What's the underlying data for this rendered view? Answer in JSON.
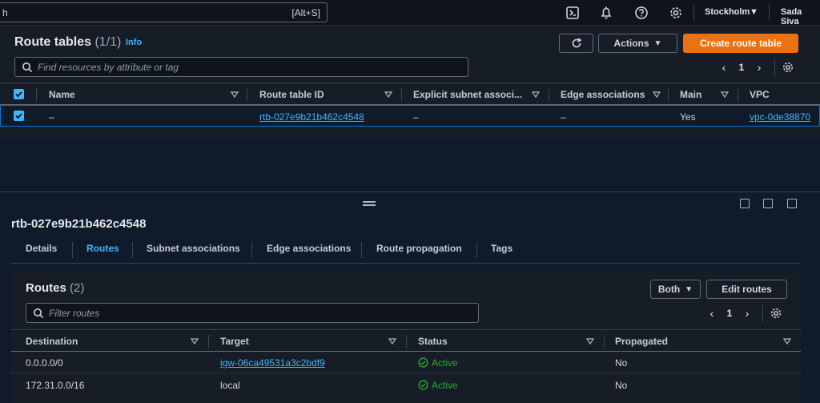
{
  "topnav": {
    "search_value": "h",
    "search_shortcut": "[Alt+S]",
    "region": "Stockholm",
    "user": "Sada Siva"
  },
  "route_tables": {
    "title": "Route tables",
    "count": "(1/1)",
    "info": "Info",
    "actions_label": "Actions",
    "create_label": "Create route table",
    "filter_placeholder": "Find resources by attribute or tag",
    "page": "1",
    "columns": [
      "Name",
      "Route table ID",
      "Explicit subnet associ...",
      "Edge associations",
      "Main",
      "VPC"
    ],
    "rows": [
      {
        "name": "–",
        "id": "rtb-027e9b21b462c4548",
        "explicit": "–",
        "edge": "–",
        "main": "Yes",
        "vpc": "vpc-0de38870"
      }
    ]
  },
  "detail": {
    "title": "rtb-027e9b21b462c4548",
    "tabs": [
      "Details",
      "Routes",
      "Subnet associations",
      "Edge associations",
      "Route propagation",
      "Tags"
    ],
    "active_tab": "Routes"
  },
  "routes": {
    "title": "Routes",
    "count": "(2)",
    "both_label": "Both",
    "edit_label": "Edit routes",
    "filter_placeholder": "Filter routes",
    "page": "1",
    "columns": [
      "Destination",
      "Target",
      "Status",
      "Propagated"
    ],
    "rows": [
      {
        "destination": "0.0.0.0/0",
        "target": "igw-06ca49531a3c2bdf9",
        "status": "Active",
        "propagated": "No"
      },
      {
        "destination": "172.31.0.0/16",
        "target": "local",
        "status": "Active",
        "propagated": "No"
      }
    ]
  },
  "colors": {
    "accent": "#42b4ff",
    "primary": "#ec7211",
    "success": "#29ad32"
  }
}
